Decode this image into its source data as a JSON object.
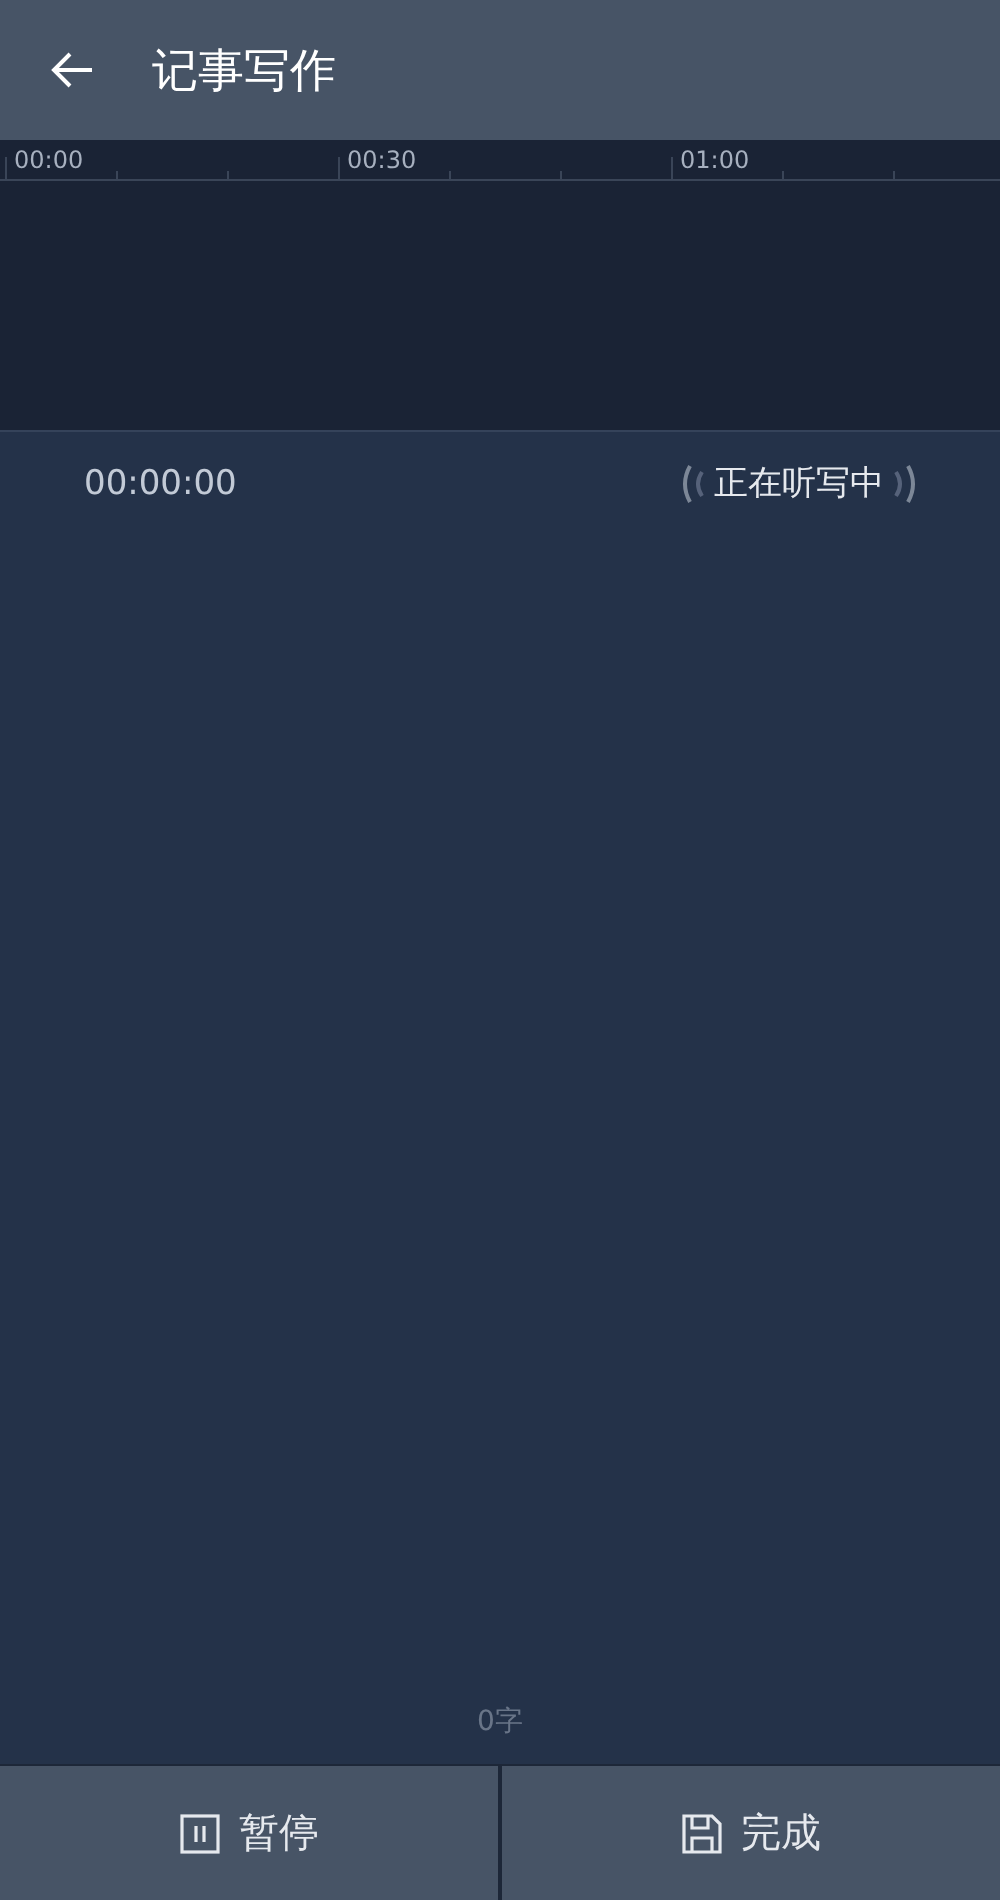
{
  "header": {
    "title": "记事写作"
  },
  "timeline": {
    "labels": [
      "00:00",
      "00:30",
      "01:00"
    ]
  },
  "status": {
    "elapsed": "00:00:00",
    "listening": "正在听写中"
  },
  "word_count": "0字",
  "buttons": [
    {
      "kind": "pause",
      "label": "暂停"
    },
    {
      "kind": "save",
      "label": "完成"
    }
  ]
}
